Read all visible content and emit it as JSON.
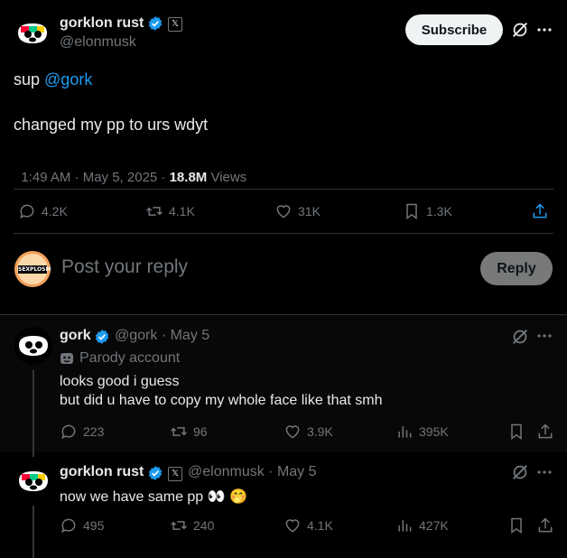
{
  "main_post": {
    "author_name": "gorklon rust",
    "handle": "@elonmusk",
    "x_badge": "𝕏",
    "subscribe_label": "Subscribe",
    "mention": "@gork",
    "text_line1_prefix": "sup ",
    "text_line2": "changed my pp to urs wdyt",
    "timestamp": "1:49 AM · May 5, 2025 · ",
    "views_count": "18.8M",
    "views_label": " Views",
    "stats": {
      "replies": "4.2K",
      "reposts": "4.1K",
      "likes": "31K",
      "bookmarks": "1.3K"
    }
  },
  "composer": {
    "avatar_text": "SEXPLOSM",
    "placeholder": "Post your reply",
    "reply_button": "Reply"
  },
  "replies": [
    {
      "author_name": "gork",
      "handle_date": "@gork · May 5",
      "parody_label": "Parody account",
      "line1": "looks good i guess",
      "line2": "but did u have to copy my whole face like that smh",
      "stats": {
        "replies": "223",
        "reposts": "96",
        "likes": "3.9K",
        "views": "395K"
      }
    },
    {
      "author_name": "gorklon rust",
      "x_badge": "𝕏",
      "handle_date": "@elonmusk · May 5",
      "text": "now we have same pp 👀 🤭",
      "stats": {
        "replies": "495",
        "reposts": "240",
        "likes": "4.1K",
        "views": "427K"
      }
    }
  ],
  "colors": {
    "background": "#000000",
    "accent_blue": "#1d9bf0",
    "muted": "#71767b",
    "divider": "#2f3336",
    "verified": "#1d9bf0"
  }
}
